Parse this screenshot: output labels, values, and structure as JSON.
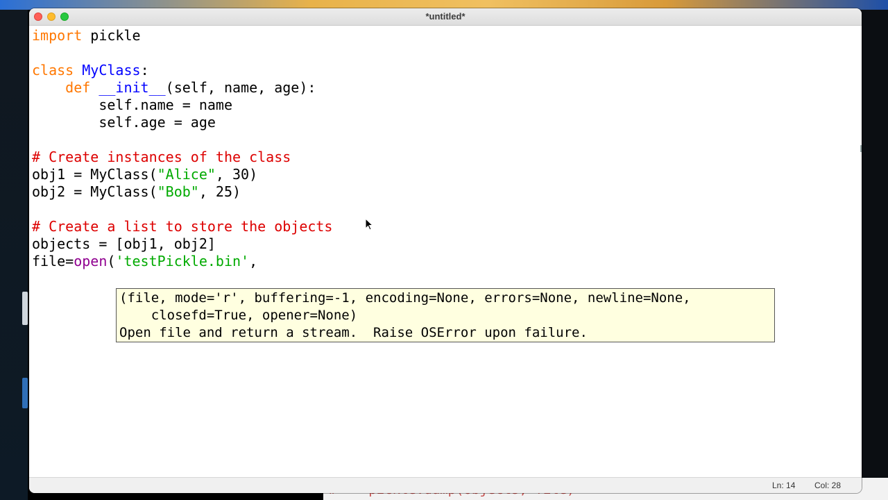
{
  "window": {
    "title": "*untitled*"
  },
  "code": {
    "line1": {
      "kw": "import",
      "rest": " pickle"
    },
    "line3": {
      "kw": "class",
      "space": " ",
      "name": "MyClass",
      "rest": ":"
    },
    "line4": {
      "indent": "    ",
      "kw": "def",
      "space": " ",
      "name": "__init__",
      "rest": "(self, name, age):"
    },
    "line5": {
      "text": "        self.name = name"
    },
    "line6": {
      "text": "        self.age = age"
    },
    "line8": {
      "comment": "# Create instances of the class"
    },
    "line9": {
      "pre": "obj1 = MyClass(",
      "str": "\"Alice\"",
      "post": ", 30)"
    },
    "line10": {
      "pre": "obj2 = MyClass(",
      "str": "\"Bob\"",
      "post": ", 25)"
    },
    "line12": {
      "comment": "# Create a list to store the objects"
    },
    "line13": {
      "text": "objects = [obj1, obj2]"
    },
    "line14": {
      "pre": "file=",
      "builtin": "open",
      "paren": "(",
      "str": "'testPickle.bin'",
      "post": ","
    }
  },
  "calltip": {
    "line1": "(file, mode='r', buffering=-1, encoding=None, errors=None, newline=None,",
    "line2": "    closefd=True, opener=None)",
    "line3": "Open file and return a stream.  Raise OSError upon failure."
  },
  "statusbar": {
    "line": "Ln: 14",
    "col": "Col: 28"
  },
  "background_window": {
    "code": "#    pickle.dump(objects, file)"
  },
  "colors": {
    "keyword": "#ff7700",
    "definition": "#0000ff",
    "string": "#00aa00",
    "comment": "#dd0000",
    "builtin": "#900090",
    "calltip_bg": "#ffffe0"
  },
  "icons": [
    "close-icon",
    "minimize-icon",
    "zoom-icon",
    "mouse-pointer-icon"
  ]
}
